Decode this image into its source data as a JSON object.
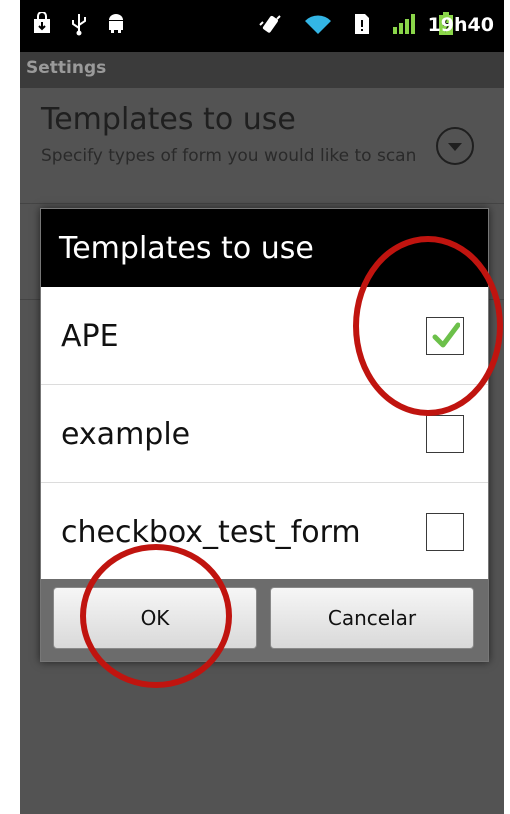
{
  "status_bar": {
    "time": "19h40",
    "icons_left": [
      "shopping-bag-icon",
      "usb-icon",
      "android-icon"
    ],
    "icons_right": [
      "vibrate-icon",
      "wifi-icon",
      "sim-icon",
      "signal-icon",
      "battery-charging-icon"
    ]
  },
  "window": {
    "title": "Settings"
  },
  "preference": {
    "title": "Templates to use",
    "summary": "Specify types of form you would like to scan"
  },
  "dialog": {
    "title": "Templates to use",
    "items": [
      {
        "label": "APE",
        "checked": true
      },
      {
        "label": "example",
        "checked": false
      },
      {
        "label": "checkbox_test_form",
        "checked": false
      }
    ],
    "ok_label": "OK",
    "cancel_label": "Cancelar"
  },
  "colors": {
    "annotation": "#c0140f",
    "check": "#6cc04a"
  }
}
